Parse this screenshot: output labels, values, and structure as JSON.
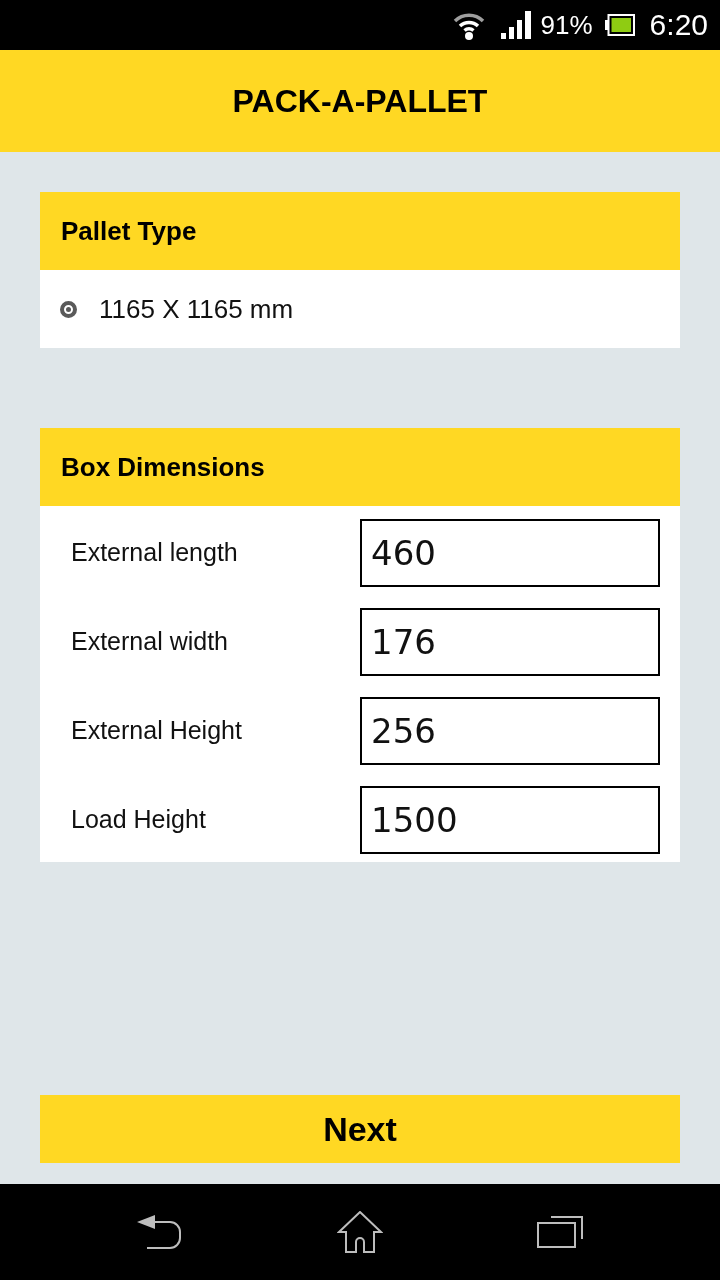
{
  "status_bar": {
    "battery": "91%",
    "time": "6:20"
  },
  "app_bar": {
    "title": "PACK-A-PALLET"
  },
  "pallet_type": {
    "heading": "Pallet Type",
    "options": [
      {
        "label": "1165 X 1165 mm",
        "selected": true
      }
    ]
  },
  "box_dimensions": {
    "heading": "Box Dimensions",
    "fields": [
      {
        "label": "External length",
        "value": "460"
      },
      {
        "label": "External width",
        "value": "176"
      },
      {
        "label": "External Height",
        "value": "256"
      },
      {
        "label": "Load Height",
        "value": "1500"
      }
    ]
  },
  "next_button": {
    "label": "Next"
  }
}
